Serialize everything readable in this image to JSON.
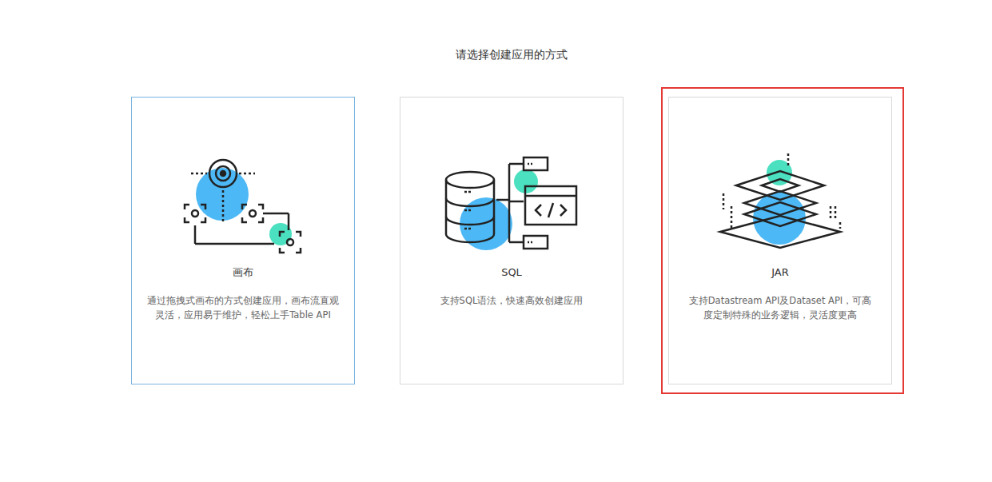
{
  "page": {
    "title": "请选择创建应用的方式"
  },
  "cards": [
    {
      "kind": "canvas",
      "label": "画布",
      "description": "通过拖拽式画布的方式创建应用，画布流直观灵活，应用易于维护，轻松上手Table API",
      "selected": true,
      "highlighted": false
    },
    {
      "kind": "sql",
      "label": "SQL",
      "description": "支持SQL语法，快速高效创建应用",
      "selected": false,
      "highlighted": false
    },
    {
      "kind": "jar",
      "label": "JAR",
      "description": "支持Datastream API及Dataset API，可高度定制特殊的业务逻辑，灵活度更高",
      "selected": false,
      "highlighted": true
    }
  ]
}
